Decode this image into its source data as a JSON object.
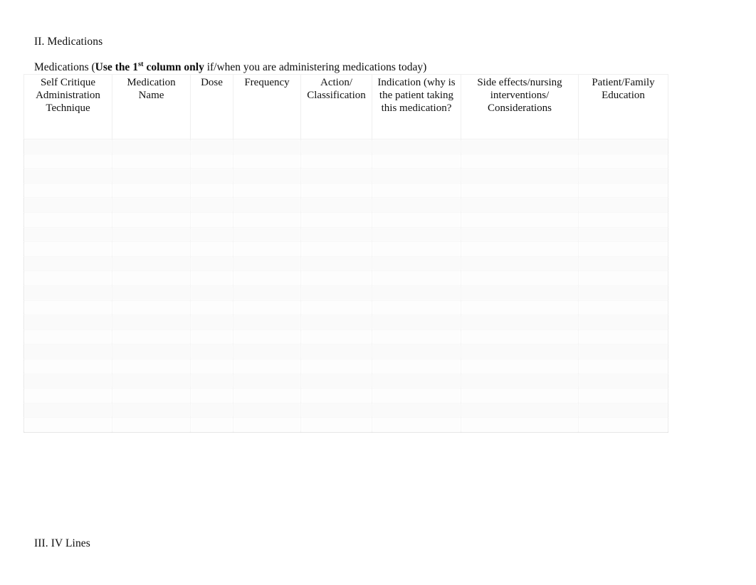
{
  "document": {
    "sections": {
      "medications_heading": "II. Medications",
      "iv_lines_heading": "III. IV Lines"
    },
    "intro": {
      "prefix": "Medications (",
      "bold_part_a": "Use the 1",
      "bold_superscript": "st",
      "bold_part_b": " column only",
      "suffix": " if/when you are administering medications today)"
    }
  },
  "table": {
    "columns": [
      {
        "id": "self-critique",
        "label": "Self Critique Administration Technique"
      },
      {
        "id": "medication-name",
        "label": "Medication Name"
      },
      {
        "id": "dose",
        "label": "Dose"
      },
      {
        "id": "frequency",
        "label": "Frequency"
      },
      {
        "id": "action-classification",
        "label": "Action/ Classification"
      },
      {
        "id": "indication",
        "label": "Indication (why is the patient taking this medication?"
      },
      {
        "id": "side-effects",
        "label": "Side effects/nursing interventions/ Considerations"
      },
      {
        "id": "patient-family-education",
        "label": "Patient/Family Education"
      }
    ],
    "body_row_count": 20,
    "rows": [
      [
        "",
        "",
        "",
        "",
        "",
        "",
        "",
        ""
      ],
      [
        "",
        "",
        "",
        "",
        "",
        "",
        "",
        ""
      ],
      [
        "",
        "",
        "",
        "",
        "",
        "",
        "",
        ""
      ],
      [
        "",
        "",
        "",
        "",
        "",
        "",
        "",
        ""
      ],
      [
        "",
        "",
        "",
        "",
        "",
        "",
        "",
        ""
      ],
      [
        "",
        "",
        "",
        "",
        "",
        "",
        "",
        ""
      ],
      [
        "",
        "",
        "",
        "",
        "",
        "",
        "",
        ""
      ],
      [
        "",
        "",
        "",
        "",
        "",
        "",
        "",
        ""
      ],
      [
        "",
        "",
        "",
        "",
        "",
        "",
        "",
        ""
      ],
      [
        "",
        "",
        "",
        "",
        "",
        "",
        "",
        ""
      ],
      [
        "",
        "",
        "",
        "",
        "",
        "",
        "",
        ""
      ],
      [
        "",
        "",
        "",
        "",
        "",
        "",
        "",
        ""
      ],
      [
        "",
        "",
        "",
        "",
        "",
        "",
        "",
        ""
      ],
      [
        "",
        "",
        "",
        "",
        "",
        "",
        "",
        ""
      ],
      [
        "",
        "",
        "",
        "",
        "",
        "",
        "",
        ""
      ],
      [
        "",
        "",
        "",
        "",
        "",
        "",
        "",
        ""
      ],
      [
        "",
        "",
        "",
        "",
        "",
        "",
        "",
        ""
      ],
      [
        "",
        "",
        "",
        "",
        "",
        "",
        "",
        ""
      ],
      [
        "",
        "",
        "",
        "",
        "",
        "",
        "",
        ""
      ],
      [
        "",
        "",
        "",
        "",
        "",
        "",
        "",
        ""
      ]
    ]
  },
  "colors": {
    "page_background": "#ffffff",
    "text": "#0d0d0d",
    "grid_line": "#e9e9e9",
    "cell_fill": "#fbfbfb"
  }
}
